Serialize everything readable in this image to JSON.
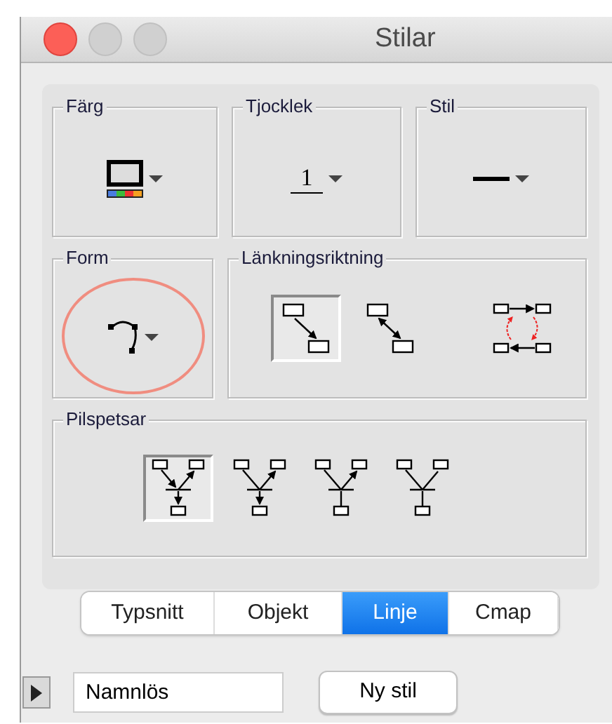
{
  "window": {
    "title": "Stilar"
  },
  "top_groups": [
    {
      "label": "Färg",
      "kind": "color"
    },
    {
      "label": "Tjocklek",
      "kind": "thickness",
      "value": "1"
    },
    {
      "label": "Stil",
      "kind": "style"
    }
  ],
  "form": {
    "label": "Form",
    "highlighted": true
  },
  "link_direction": {
    "label": "Länkningsriktning",
    "options": [
      {
        "kind": "one-way",
        "selected": true
      },
      {
        "kind": "two-way",
        "selected": false
      },
      {
        "kind": "cycle",
        "selected": false
      }
    ]
  },
  "arrowheads": {
    "label": "Pilspetsar",
    "options": [
      {
        "kind": "all",
        "selected": true
      },
      {
        "kind": "out-and-down",
        "selected": false
      },
      {
        "kind": "out",
        "selected": false
      },
      {
        "kind": "none",
        "selected": false
      }
    ]
  },
  "tabs": [
    {
      "label": "Typsnitt",
      "selected": false
    },
    {
      "label": "Objekt",
      "selected": false
    },
    {
      "label": "Linje",
      "selected": true
    },
    {
      "label": "Cmap",
      "selected": false
    }
  ],
  "name_field": {
    "value": "Namnlös"
  },
  "new_style_button": "Ny stil"
}
